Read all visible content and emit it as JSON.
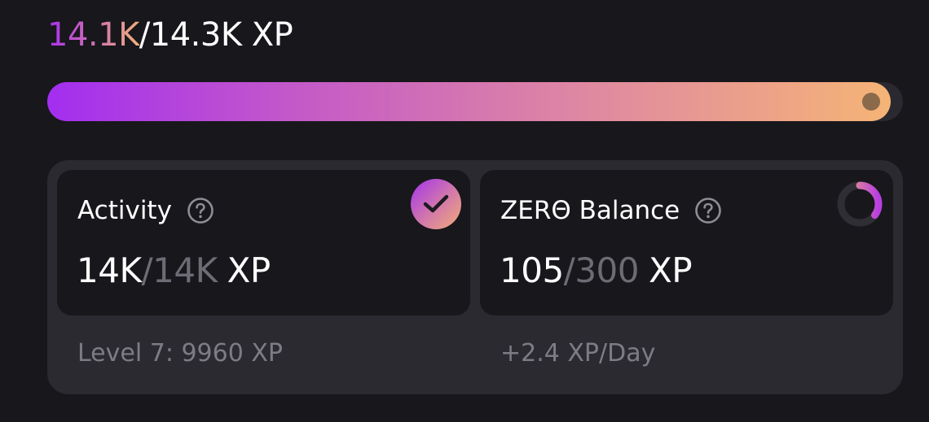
{
  "header": {
    "current": "14.1K",
    "rest": "/14.3K XP"
  },
  "progress": {
    "fraction": 0.986,
    "colors": [
      "#a32ef0",
      "#f5b476"
    ]
  },
  "cards": {
    "activity": {
      "title": "Activity",
      "help_icon": "question-circle-icon",
      "value": "14K",
      "total": "/14K",
      "unit": "XP",
      "status_icon": "check-circle-icon",
      "footer": "Level 7: 9960 XP"
    },
    "balance": {
      "title": "ZERΘ Balance",
      "help_icon": "question-circle-icon",
      "value": "105",
      "total": "/300",
      "unit": "XP",
      "status_icon": "progress-ring-icon",
      "ring_fraction": 0.35,
      "footer": "+2.4 XP/Day"
    }
  }
}
